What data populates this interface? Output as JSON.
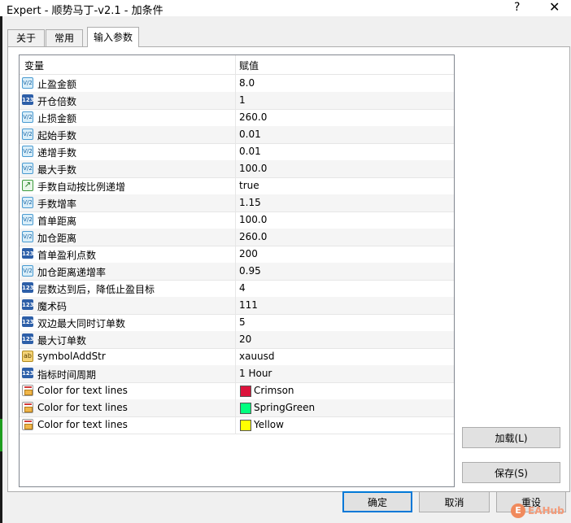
{
  "window": {
    "title": "Expert - 顺势马丁-v2.1 - 加条件",
    "help_glyph": "?",
    "close_glyph": "✕"
  },
  "tabs": [
    {
      "label": "关于",
      "active": false
    },
    {
      "label": "常用",
      "active": false
    },
    {
      "label": "输入参数",
      "active": true
    }
  ],
  "grid": {
    "headers": {
      "variable": "变量",
      "value": "赋值"
    },
    "rows": [
      {
        "icon": "v2",
        "icon_text": "V/2",
        "name": "止盈金额",
        "value": "8.0"
      },
      {
        "icon": "n123",
        "icon_text": "123",
        "name": "开仓倍数",
        "value": "1"
      },
      {
        "icon": "v2",
        "icon_text": "V/2",
        "name": "止损金额",
        "value": "260.0"
      },
      {
        "icon": "v2",
        "icon_text": "V/2",
        "name": "起始手数",
        "value": "0.01"
      },
      {
        "icon": "v2",
        "icon_text": "V/2",
        "name": "递增手数",
        "value": "0.01"
      },
      {
        "icon": "v2",
        "icon_text": "V/2",
        "name": "最大手数",
        "value": "100.0"
      },
      {
        "icon": "bool",
        "icon_text": "↗",
        "name": "手数自动按比例递增",
        "value": "true"
      },
      {
        "icon": "v2",
        "icon_text": "V/2",
        "name": "手数增率",
        "value": "1.15"
      },
      {
        "icon": "v2",
        "icon_text": "V/2",
        "name": "首单距离",
        "value": "100.0"
      },
      {
        "icon": "v2",
        "icon_text": "V/2",
        "name": "加仓距离",
        "value": "260.0"
      },
      {
        "icon": "n123",
        "icon_text": "123",
        "name": "首单盈利点数",
        "value": "200"
      },
      {
        "icon": "v2",
        "icon_text": "V/2",
        "name": "加仓距离递增率",
        "value": "0.95"
      },
      {
        "icon": "n123",
        "icon_text": "123",
        "name": "层数达到后，降低止盈目标",
        "value": "4"
      },
      {
        "icon": "n123",
        "icon_text": "123",
        "name": "魔术码",
        "value": "111"
      },
      {
        "icon": "n123",
        "icon_text": "123",
        "name": "双边最大同时订单数",
        "value": "5"
      },
      {
        "icon": "n123",
        "icon_text": "123",
        "name": "最大订单数",
        "value": "20"
      },
      {
        "icon": "ab",
        "icon_text": "ab",
        "name": "symbolAddStr",
        "value": "xauusd"
      },
      {
        "icon": "n123",
        "icon_text": "123",
        "name": "指标时间周期",
        "value": "1 Hour"
      },
      {
        "icon": "color",
        "icon_text": "",
        "name": "Color for text lines",
        "value": "Crimson",
        "swatch": "#dc143c"
      },
      {
        "icon": "color",
        "icon_text": "",
        "name": "Color for text lines",
        "value": "SpringGreen",
        "swatch": "#00ff7f"
      },
      {
        "icon": "color",
        "icon_text": "",
        "name": "Color for text lines",
        "value": "Yellow",
        "swatch": "#ffff00"
      }
    ]
  },
  "side_buttons": {
    "load": "加载(L)",
    "save": "保存(S)"
  },
  "footer_buttons": {
    "ok": "确定",
    "cancel": "取消",
    "reset": "重设"
  },
  "watermark": {
    "logo_text": "E",
    "text": "EAHub"
  },
  "colors": {
    "accent": "#0078d7"
  }
}
